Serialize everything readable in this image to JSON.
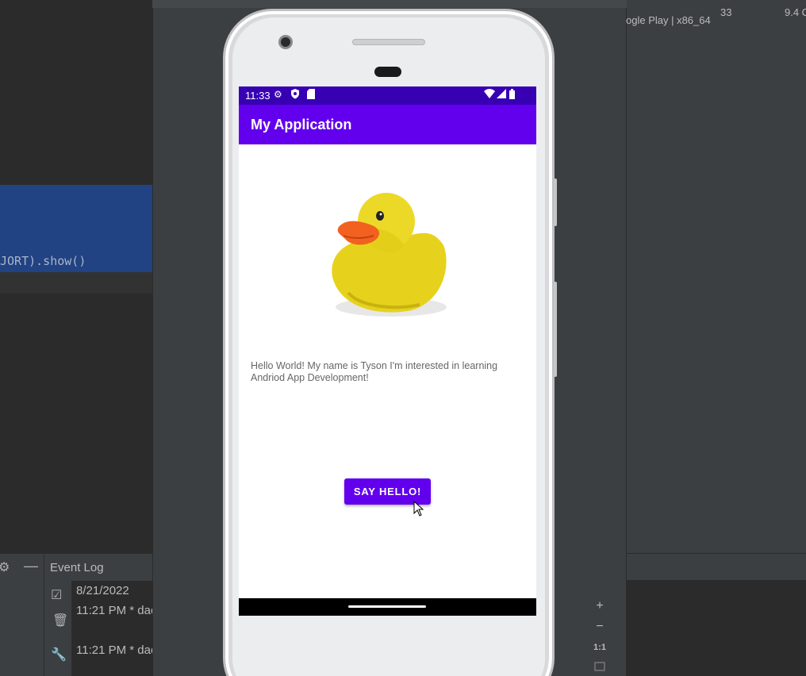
{
  "editor": {
    "code_fragment": "JORT).show()"
  },
  "right_panel": {
    "device_info": "ogle Play | x86_64",
    "api_level": "33",
    "size": "9.4 C"
  },
  "event_log": {
    "title": "Event Log",
    "entries": [
      {
        "text": "8/21/2022"
      },
      {
        "text": "11:21 PM * dae"
      },
      {
        "text": "11:21 PM * dae"
      }
    ]
  },
  "device": {
    "status_bar": {
      "time": "11:33"
    },
    "app_bar": {
      "title": "My Application"
    },
    "content": {
      "message": "Hello World! My name is Tyson I'm interested in learning Andriod App Development!",
      "button_label": "SAY HELLO!"
    }
  },
  "zoom_controls": {
    "zoom_in": "+",
    "zoom_out": "−",
    "actual_size": "1:1"
  },
  "colors": {
    "status_bar": "#3700b3",
    "app_bar": "#6200ee",
    "button": "#6200ee",
    "selection": "#214283"
  }
}
